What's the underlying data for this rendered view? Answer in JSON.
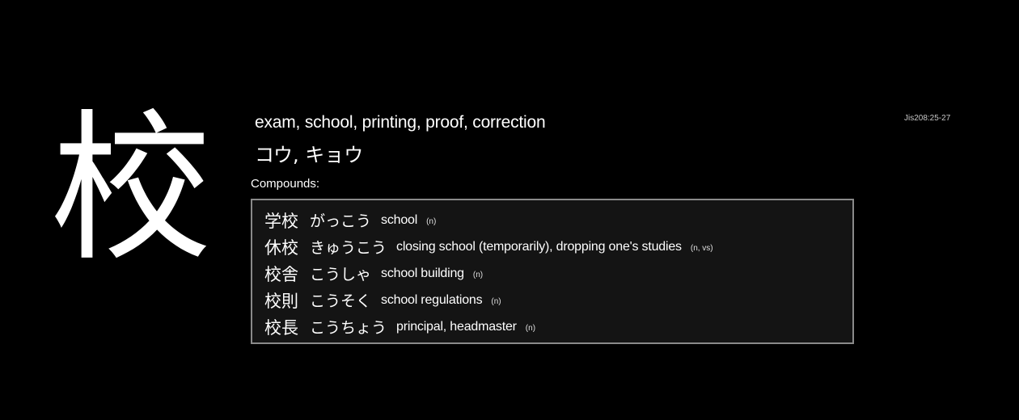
{
  "kanji": "校",
  "meanings": "exam, school, printing, proof, correction",
  "readings": "コウ, キョウ",
  "jis": "Jis208:25-27",
  "compounds_label": "Compounds:",
  "compounds": [
    {
      "word": "学校",
      "reading": "がっこう",
      "gloss": "school",
      "pos": "(n)"
    },
    {
      "word": "休校",
      "reading": "きゅうこう",
      "gloss": "closing school (temporarily), dropping one's studies",
      "pos": "(n, vs)"
    },
    {
      "word": "校舎",
      "reading": "こうしゃ",
      "gloss": "school building",
      "pos": "(n)"
    },
    {
      "word": "校則",
      "reading": "こうそく",
      "gloss": "school regulations",
      "pos": "(n)"
    },
    {
      "word": "校長",
      "reading": "こうちょう",
      "gloss": "principal, headmaster",
      "pos": "(n)"
    }
  ]
}
